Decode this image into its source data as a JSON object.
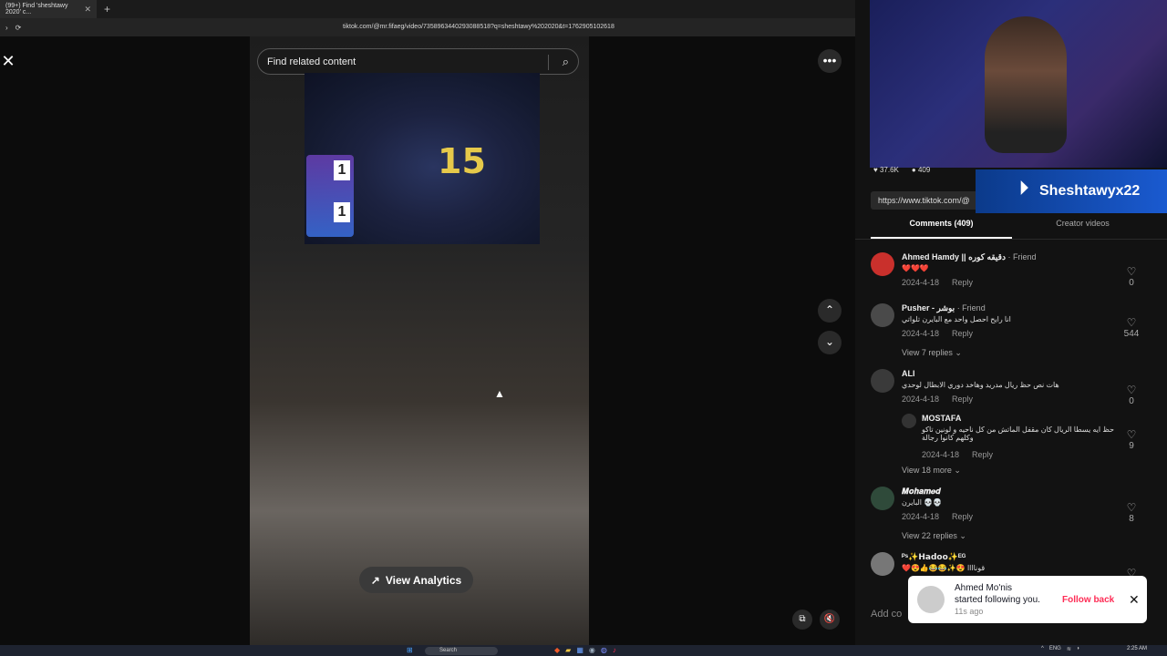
{
  "browser": {
    "tab_title": "(99+) Find 'sheshtawy 2020' c...",
    "tab_close": "✕",
    "new_tab": "+",
    "url": "tiktok.com/@mr.fifaeg/video/7358963440293088518?q=sheshtawy%202020&t=1762905102618"
  },
  "video_page": {
    "close": "✕",
    "search_placeholder": "Find related content",
    "more": "•••",
    "jersey_number": "15",
    "score_top": "1",
    "score_bottom": "1",
    "up": "⌃",
    "down": "⌄",
    "analytics_label": "View Analytics",
    "cursor": "▲"
  },
  "stream_overlay": {
    "likes": "37.6K",
    "comments_count": "409",
    "channel_name": "Sheshtawyx22",
    "brand_logo": "P"
  },
  "side_panel": {
    "link": "https://www.tiktok.com/@",
    "tab_comments": "Comments (409)",
    "tab_creator": "Creator videos",
    "comments": [
      {
        "name": "Ahmed Hamdy || دقيقه كوره",
        "tag": " · Friend",
        "text": "❤️❤️❤️",
        "date": "2024-4-18",
        "reply": "Reply",
        "likes": "0"
      },
      {
        "name": "Pusher - بوشر",
        "tag": " · Friend",
        "text": "انا رايح احصل واحد مع البايرن تلواتي",
        "date": "2024-4-18",
        "reply": "Reply",
        "likes": "544",
        "view_replies": "View 7 replies ⌄"
      },
      {
        "name": "ALI",
        "tag": "",
        "text": "هات نص حظ ريال مدريد وهاخد دوري الابطال لوحدي",
        "date": "2024-4-18",
        "reply": "Reply",
        "likes": "0"
      },
      {
        "name": "MOSTAFA",
        "tag": "",
        "text": "حظ ايه يسطا الريال كان مقفل الماتش من كل ناحيه و لونين تاكو وكلهم كانوا رجالة",
        "date": "2024-4-18",
        "reply": "Reply",
        "likes": "9",
        "view_replies": "View 18 more ⌄"
      },
      {
        "name": "𝑴𝒐𝒉𝒂𝒎𝒆𝒅",
        "tag": "",
        "text": "البايرن 💀💀",
        "date": "2024-4-18",
        "reply": "Reply",
        "likes": "8",
        "view_replies": "View 22 replies ⌄"
      },
      {
        "name": "ᴾˢ✨𝗛𝗮𝗱𝗼𝗼✨ᴱᴳ",
        "tag": "",
        "text": "❤️😍👍😂😂✨😍 قوناااا"
      }
    ],
    "add_comment": "Add co"
  },
  "toast": {
    "name": "Ahmed Mo'nis",
    "message": "started following you.",
    "time": "11s ago",
    "follow_back": "Follow back",
    "close": "✕"
  },
  "taskbar": {
    "search": "Search",
    "lang": "ENG",
    "time": "2:25 AM"
  }
}
